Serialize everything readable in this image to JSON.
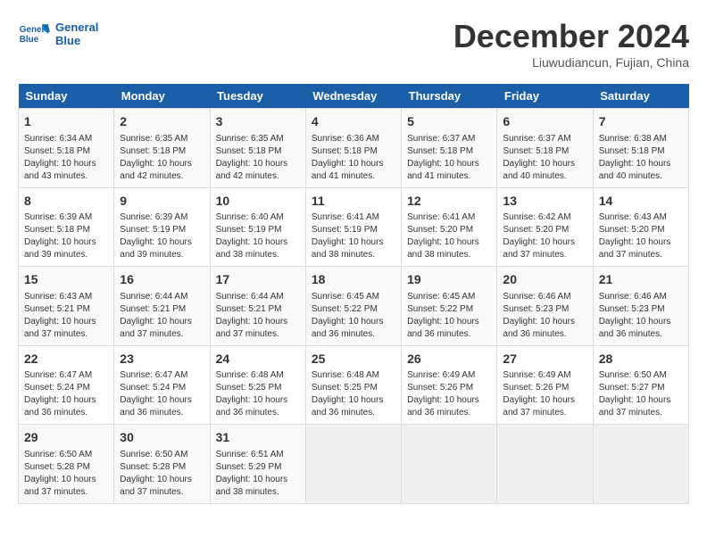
{
  "header": {
    "logo_line1": "General",
    "logo_line2": "Blue",
    "month_title": "December 2024",
    "location": "Liuwudiancun, Fujian, China"
  },
  "days_of_week": [
    "Sunday",
    "Monday",
    "Tuesday",
    "Wednesday",
    "Thursday",
    "Friday",
    "Saturday"
  ],
  "weeks": [
    [
      {
        "day": "1",
        "info": "Sunrise: 6:34 AM\nSunset: 5:18 PM\nDaylight: 10 hours\nand 43 minutes."
      },
      {
        "day": "2",
        "info": "Sunrise: 6:35 AM\nSunset: 5:18 PM\nDaylight: 10 hours\nand 42 minutes."
      },
      {
        "day": "3",
        "info": "Sunrise: 6:35 AM\nSunset: 5:18 PM\nDaylight: 10 hours\nand 42 minutes."
      },
      {
        "day": "4",
        "info": "Sunrise: 6:36 AM\nSunset: 5:18 PM\nDaylight: 10 hours\nand 41 minutes."
      },
      {
        "day": "5",
        "info": "Sunrise: 6:37 AM\nSunset: 5:18 PM\nDaylight: 10 hours\nand 41 minutes."
      },
      {
        "day": "6",
        "info": "Sunrise: 6:37 AM\nSunset: 5:18 PM\nDaylight: 10 hours\nand 40 minutes."
      },
      {
        "day": "7",
        "info": "Sunrise: 6:38 AM\nSunset: 5:18 PM\nDaylight: 10 hours\nand 40 minutes."
      }
    ],
    [
      {
        "day": "8",
        "info": "Sunrise: 6:39 AM\nSunset: 5:18 PM\nDaylight: 10 hours\nand 39 minutes."
      },
      {
        "day": "9",
        "info": "Sunrise: 6:39 AM\nSunset: 5:19 PM\nDaylight: 10 hours\nand 39 minutes."
      },
      {
        "day": "10",
        "info": "Sunrise: 6:40 AM\nSunset: 5:19 PM\nDaylight: 10 hours\nand 38 minutes."
      },
      {
        "day": "11",
        "info": "Sunrise: 6:41 AM\nSunset: 5:19 PM\nDaylight: 10 hours\nand 38 minutes."
      },
      {
        "day": "12",
        "info": "Sunrise: 6:41 AM\nSunset: 5:20 PM\nDaylight: 10 hours\nand 38 minutes."
      },
      {
        "day": "13",
        "info": "Sunrise: 6:42 AM\nSunset: 5:20 PM\nDaylight: 10 hours\nand 37 minutes."
      },
      {
        "day": "14",
        "info": "Sunrise: 6:43 AM\nSunset: 5:20 PM\nDaylight: 10 hours\nand 37 minutes."
      }
    ],
    [
      {
        "day": "15",
        "info": "Sunrise: 6:43 AM\nSunset: 5:21 PM\nDaylight: 10 hours\nand 37 minutes."
      },
      {
        "day": "16",
        "info": "Sunrise: 6:44 AM\nSunset: 5:21 PM\nDaylight: 10 hours\nand 37 minutes."
      },
      {
        "day": "17",
        "info": "Sunrise: 6:44 AM\nSunset: 5:21 PM\nDaylight: 10 hours\nand 37 minutes."
      },
      {
        "day": "18",
        "info": "Sunrise: 6:45 AM\nSunset: 5:22 PM\nDaylight: 10 hours\nand 36 minutes."
      },
      {
        "day": "19",
        "info": "Sunrise: 6:45 AM\nSunset: 5:22 PM\nDaylight: 10 hours\nand 36 minutes."
      },
      {
        "day": "20",
        "info": "Sunrise: 6:46 AM\nSunset: 5:23 PM\nDaylight: 10 hours\nand 36 minutes."
      },
      {
        "day": "21",
        "info": "Sunrise: 6:46 AM\nSunset: 5:23 PM\nDaylight: 10 hours\nand 36 minutes."
      }
    ],
    [
      {
        "day": "22",
        "info": "Sunrise: 6:47 AM\nSunset: 5:24 PM\nDaylight: 10 hours\nand 36 minutes."
      },
      {
        "day": "23",
        "info": "Sunrise: 6:47 AM\nSunset: 5:24 PM\nDaylight: 10 hours\nand 36 minutes."
      },
      {
        "day": "24",
        "info": "Sunrise: 6:48 AM\nSunset: 5:25 PM\nDaylight: 10 hours\nand 36 minutes."
      },
      {
        "day": "25",
        "info": "Sunrise: 6:48 AM\nSunset: 5:25 PM\nDaylight: 10 hours\nand 36 minutes."
      },
      {
        "day": "26",
        "info": "Sunrise: 6:49 AM\nSunset: 5:26 PM\nDaylight: 10 hours\nand 36 minutes."
      },
      {
        "day": "27",
        "info": "Sunrise: 6:49 AM\nSunset: 5:26 PM\nDaylight: 10 hours\nand 37 minutes."
      },
      {
        "day": "28",
        "info": "Sunrise: 6:50 AM\nSunset: 5:27 PM\nDaylight: 10 hours\nand 37 minutes."
      }
    ],
    [
      {
        "day": "29",
        "info": "Sunrise: 6:50 AM\nSunset: 5:28 PM\nDaylight: 10 hours\nand 37 minutes."
      },
      {
        "day": "30",
        "info": "Sunrise: 6:50 AM\nSunset: 5:28 PM\nDaylight: 10 hours\nand 37 minutes."
      },
      {
        "day": "31",
        "info": "Sunrise: 6:51 AM\nSunset: 5:29 PM\nDaylight: 10 hours\nand 38 minutes."
      },
      {
        "day": "",
        "info": ""
      },
      {
        "day": "",
        "info": ""
      },
      {
        "day": "",
        "info": ""
      },
      {
        "day": "",
        "info": ""
      }
    ]
  ]
}
